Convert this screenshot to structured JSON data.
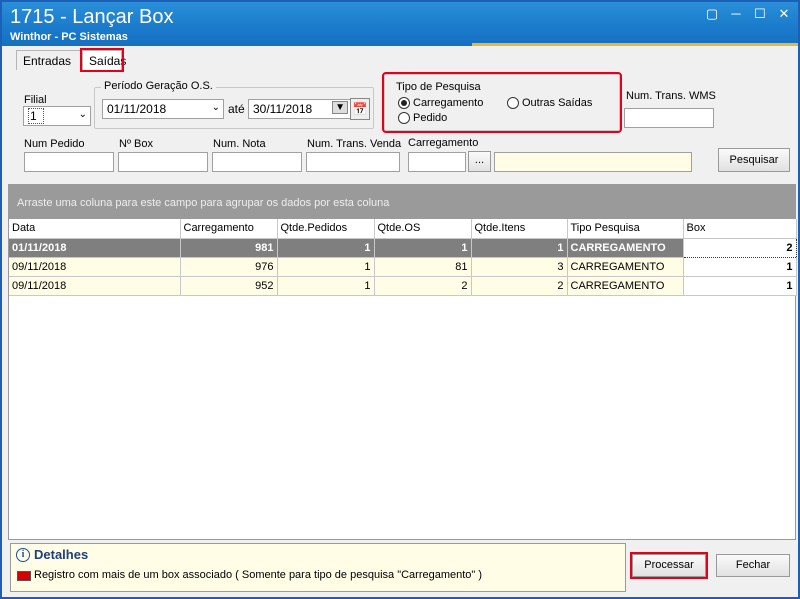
{
  "window": {
    "title": "1715 - Lançar Box",
    "subtitle": "Winthor - PC Sistemas",
    "controls": [
      "restore",
      "minimize",
      "maximize",
      "close"
    ]
  },
  "tabs": [
    {
      "label": "Entradas",
      "active": false
    },
    {
      "label": "Saídas",
      "active": true
    }
  ],
  "filters": {
    "filial_label": "Filial",
    "filial_value": "1",
    "periodo_label": "Período Geração O.S.",
    "date_from": "01/11/2018",
    "ate_label": "até",
    "date_to": "30/11/2018",
    "tipo_pesquisa_label": "Tipo de Pesquisa",
    "radio_carregamento": "Carregamento",
    "radio_outras": "Outras Saídas",
    "radio_pedido": "Pedido",
    "selected_radio": "Carregamento",
    "num_trans_wms_label": "Num. Trans. WMS",
    "num_pedido_label": "Num Pedido",
    "num_box_label": "Nº Box",
    "num_nota_label": "Num. Nota",
    "num_trans_venda_label": "Num. Trans. Venda",
    "carregamento_label": "Carregamento",
    "lookup_button": "...",
    "pesquisar_button": "Pesquisar"
  },
  "grid": {
    "group_hint": "Arraste uma coluna para este campo para agrupar os dados por esta coluna",
    "columns": [
      "Data",
      "Carregamento",
      "Qtde.Pedidos",
      "Qtde.OS",
      "Qtde.Itens",
      "Tipo Pesquisa",
      "Box"
    ],
    "rows": [
      [
        "01/11/2018",
        "981",
        "1",
        "1",
        "1",
        "CARREGAMENTO",
        "2"
      ],
      [
        "09/11/2018",
        "976",
        "1",
        "81",
        "3",
        "CARREGAMENTO",
        "1"
      ],
      [
        "09/11/2018",
        "952",
        "1",
        "2",
        "2",
        "CARREGAMENTO",
        "1"
      ]
    ]
  },
  "details": {
    "title": "Detalhes",
    "legend_text": "Registro com mais de um box associado ( Somente para tipo de pesquisa \"Carregamento\" )",
    "legend_color": "#d40000"
  },
  "actions": {
    "processar_button": "Processar",
    "fechar_button": "Fechar"
  },
  "colors": {
    "titlebar": "#1a7acb",
    "highlight": "#e3001b",
    "selected_row": "#7f7f7f",
    "row_background": "#fffde6"
  }
}
